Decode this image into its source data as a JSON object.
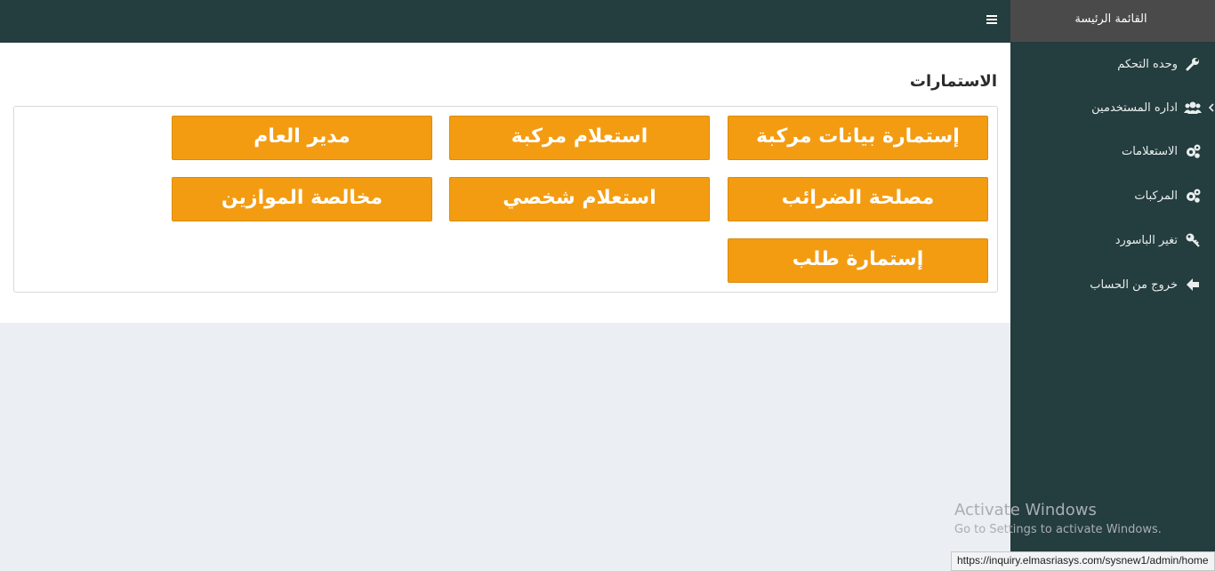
{
  "sidebar": {
    "header": "القائمة الرئيسة",
    "items": [
      {
        "label": "وحده التحكم",
        "icon": "wrench-icon"
      },
      {
        "label": "اداره المستخدمين",
        "icon": "users-icon"
      },
      {
        "label": "الاستعلامات",
        "icon": "cogs-icon"
      },
      {
        "label": "المركبات",
        "icon": "cogs-icon"
      },
      {
        "label": "تغير الباسورد",
        "icon": "key-icon"
      },
      {
        "label": "خروج من الحساب",
        "icon": "arrow-left-icon"
      }
    ]
  },
  "main": {
    "title": "الاستمارات",
    "buttons": [
      "إستمارة بيانات مركبة",
      "استعلام مركبة",
      "مدير العام",
      "مصلحة الضرائب",
      "استعلام شخصي",
      "مخالصة الموازين",
      "إستمارة طلب"
    ]
  },
  "overlay": {
    "watermark_title": "Activate Windows",
    "watermark_sub": "Go to Settings to activate Windows.",
    "status_url": "https://inquiry.elmasriasys.com/sysnew1/admin/home"
  },
  "colors": {
    "sidebar_bg": "#243d3e",
    "header_bg": "#4b4a4a",
    "button_bg": "#f39c12"
  }
}
